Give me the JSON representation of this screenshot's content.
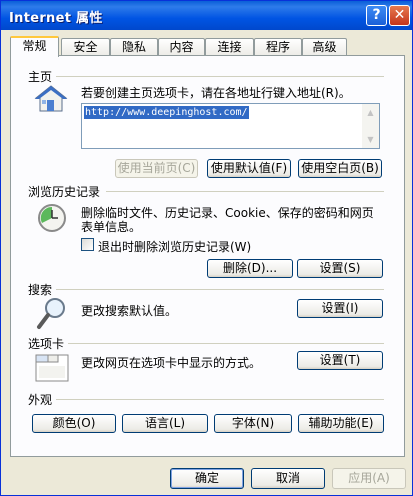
{
  "window": {
    "title": "Internet 属性",
    "help_glyph": "?",
    "close_glyph": "✕"
  },
  "tabs": [
    {
      "label": "常规",
      "active": true
    },
    {
      "label": "安全"
    },
    {
      "label": "隐私"
    },
    {
      "label": "内容"
    },
    {
      "label": "连接"
    },
    {
      "label": "程序"
    },
    {
      "label": "高级"
    }
  ],
  "home": {
    "title": "主页",
    "description": "若要创建主页选项卡，请在各地址行键入地址(R)。",
    "url": "http://www.deepinghost.com/",
    "buttons": {
      "use_current": "使用当前页(C)",
      "use_default": "使用默认值(F)",
      "use_blank": "使用空白页(B)"
    }
  },
  "history": {
    "title": "浏览历史记录",
    "description_line1": "删除临时文件、历史记录、Cookie、保存的密码和网页",
    "description_line2": "表单信息。",
    "checkbox_label": "退出时删除浏览历史记录(W)",
    "buttons": {
      "delete": "删除(D)...",
      "settings": "设置(S)"
    }
  },
  "search": {
    "title": "搜索",
    "description": "更改搜索默认值。",
    "settings": "设置(I)"
  },
  "tabs_section": {
    "title": "选项卡",
    "description": "更改网页在选项卡中显示的方式。",
    "settings": "设置(T)"
  },
  "appearance": {
    "title": "外观",
    "buttons": {
      "colors": "颜色(O)",
      "languages": "语言(L)",
      "fonts": "字体(N)",
      "accessibility": "辅助功能(E)"
    }
  },
  "footer": {
    "ok": "确定",
    "cancel": "取消",
    "apply": "应用(A)"
  }
}
